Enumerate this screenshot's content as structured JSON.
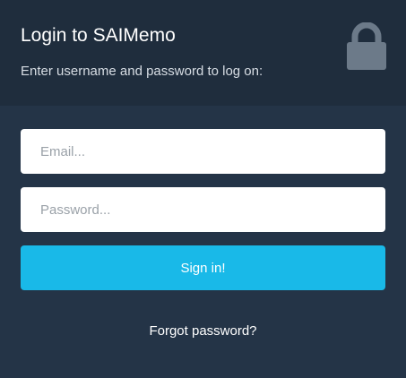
{
  "header": {
    "title": "Login to SAIMemo",
    "subtitle": "Enter username and password to log on:",
    "icon": "lock-icon"
  },
  "form": {
    "email_placeholder": "Email...",
    "email_value": "",
    "password_placeholder": "Password...",
    "password_value": "",
    "signin_label": "Sign in!",
    "forgot_label": "Forgot password?"
  },
  "colors": {
    "header_bg": "#1f2d3d",
    "body_bg": "#243447",
    "accent": "#19b9e8",
    "lock_icon": "#6c7a89"
  }
}
